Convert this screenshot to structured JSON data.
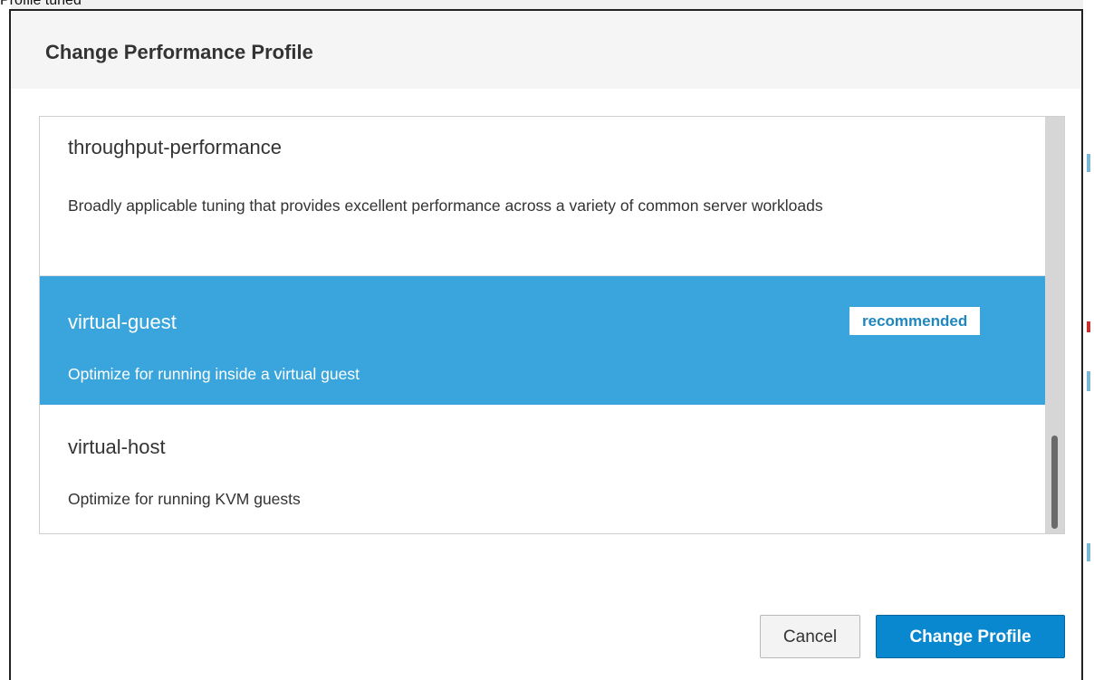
{
  "background": {
    "partial_text": "Profile tuned"
  },
  "dialog": {
    "title": "Change Performance Profile",
    "profiles": [
      {
        "name": "throughput-performance",
        "description": "Broadly applicable tuning that provides excellent performance across a variety of common server workloads",
        "selected": false,
        "badge": ""
      },
      {
        "name": "virtual-guest",
        "description": "Optimize for running inside a virtual guest",
        "selected": true,
        "badge": "recommended"
      },
      {
        "name": "virtual-host",
        "description": "Optimize for running KVM guests",
        "selected": false,
        "badge": ""
      }
    ],
    "buttons": {
      "cancel": "Cancel",
      "confirm": "Change Profile"
    }
  },
  "colors": {
    "selected_row": "#39a5dc",
    "primary_button": "#0a88cf",
    "badge_text": "#1f86bf"
  }
}
